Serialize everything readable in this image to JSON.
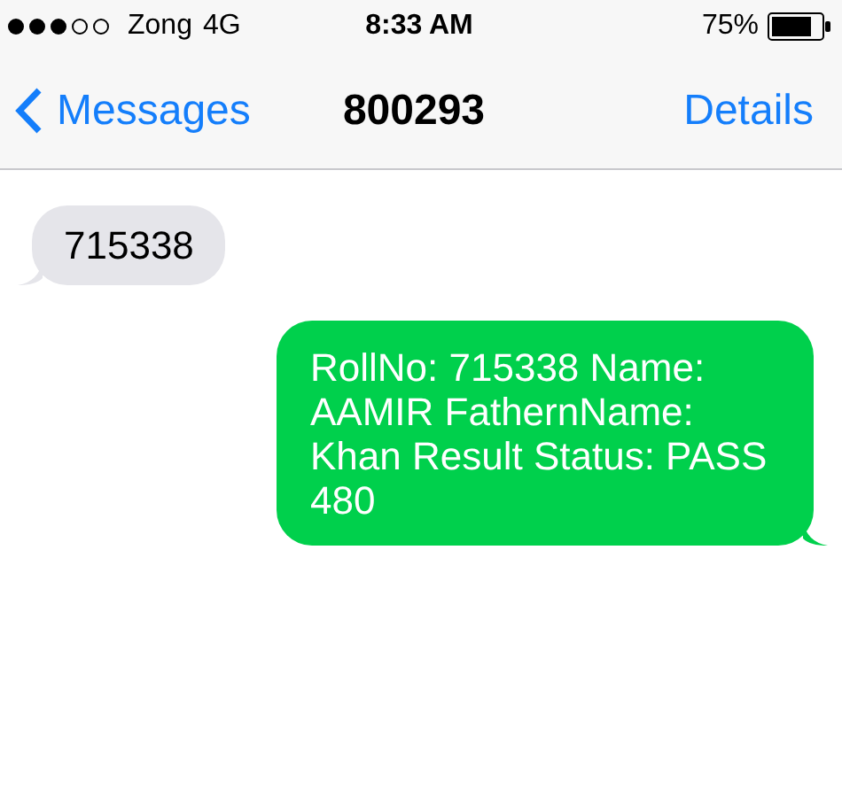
{
  "status_bar": {
    "carrier": "Zong",
    "network": "4G",
    "time": "8:33 AM",
    "battery": "75%"
  },
  "nav": {
    "back": "Messages",
    "title": "800293",
    "action": "Details"
  },
  "messages": [
    {
      "kind": "incoming",
      "text": "715338"
    },
    {
      "kind": "outgoing",
      "text": "RollNo: 715338 Name: AAMIR FathernName: Khan Result Status: PASS 480"
    }
  ]
}
